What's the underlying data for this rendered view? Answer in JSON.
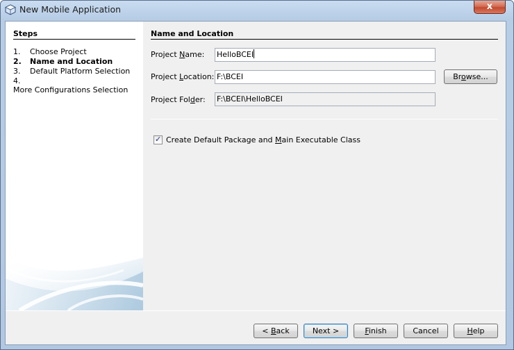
{
  "window": {
    "title": "New Mobile Application",
    "close_label": "x"
  },
  "steps": {
    "title": "Steps",
    "items": [
      {
        "num": "1.",
        "label": "Choose Project",
        "active": false
      },
      {
        "num": "2.",
        "label": "Name and Location",
        "active": true
      },
      {
        "num": "3.",
        "label": "Default Platform Selection",
        "active": false
      },
      {
        "num": "4.",
        "label": "More Configurations Selection",
        "active": false
      }
    ]
  },
  "form": {
    "section_title": "Name and Location",
    "project_name": {
      "label_pre": "Project ",
      "label_u": "N",
      "label_post": "ame:",
      "value": "HelloBCEI"
    },
    "project_location": {
      "label_pre": "Project ",
      "label_u": "L",
      "label_post": "ocation:",
      "value": "F:\\BCEI"
    },
    "project_folder": {
      "label_pre": "Project Fol",
      "label_u": "d",
      "label_post": "er:",
      "value": "F:\\BCEI\\HelloBCEI"
    },
    "browse": {
      "pre": "Br",
      "u": "o",
      "post": "wse..."
    },
    "checkbox": {
      "checked": true,
      "label_pre": "Create Default Package and ",
      "label_u": "M",
      "label_post": "ain Executable Class"
    }
  },
  "footer": {
    "back": {
      "pre": "< ",
      "u": "B",
      "post": "ack"
    },
    "next": {
      "label": "Next >"
    },
    "finish": {
      "pre": "",
      "u": "F",
      "post": "inish"
    },
    "cancel": {
      "label": "Cancel"
    },
    "help": {
      "pre": "",
      "u": "H",
      "post": "elp"
    }
  }
}
